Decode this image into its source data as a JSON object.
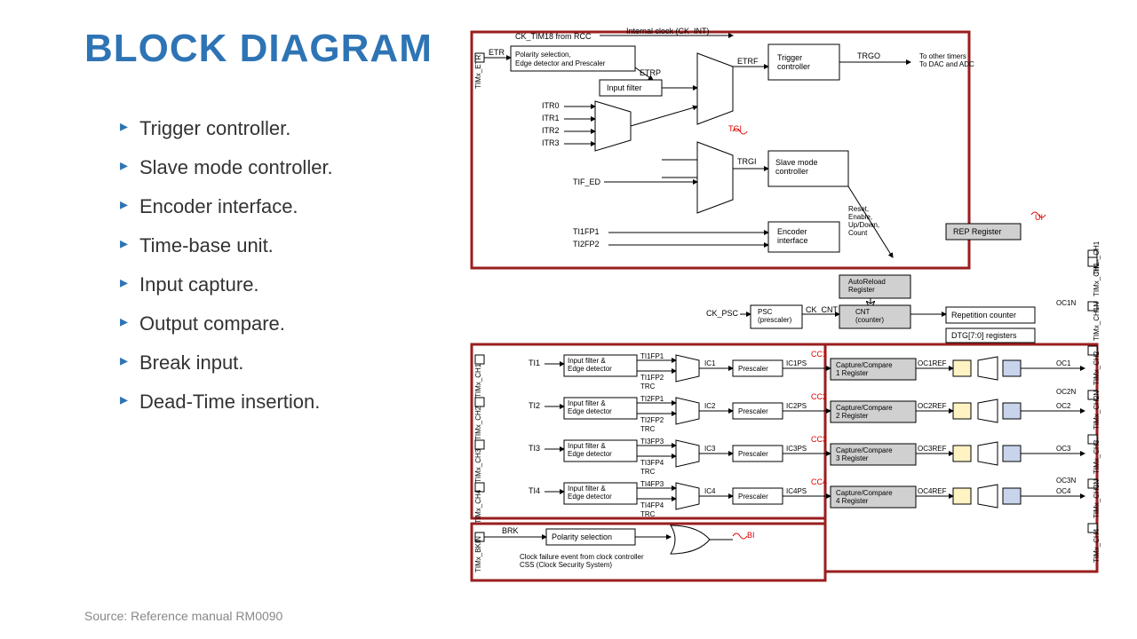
{
  "title": "BLOCK DIAGRAM",
  "bullets": [
    "Trigger controller.",
    "Slave mode controller.",
    "Encoder interface.",
    "Time-base unit.",
    "Input capture.",
    "Output compare.",
    "Break input.",
    "Dead-Time insertion."
  ],
  "source": "Source: Reference manual RM0090",
  "d": {
    "etr_pin": "TIMx_ETR",
    "etr": "ETR",
    "ck_tim18": "CK_TIM18 from RCC",
    "pol": "Polarity selection,\nEdge detector and Prescaler",
    "etrp": "ETRP",
    "inpfilt": "Input filter",
    "etrf": "ETRF",
    "ck_int": "Internal clock (CK_INT)",
    "trigctrl": "Trigger\ncontroller",
    "trgo": "TRGO",
    "to_other": "To other timers\nTo DAC and ADC",
    "itr0": "ITR0",
    "itr1": "ITR1",
    "itr2": "ITR2",
    "itr3": "ITR3",
    "tgi": "TGI",
    "trgi": "TRGI",
    "slave": "Slave mode\ncontroller",
    "tif_ed": "TIF_ED",
    "ti1fp1": "TI1FP1",
    "ti2fp2": "TI2FP2",
    "encoder": "Encoder\ninterface",
    "reset_etc": "Reset,\nEnable,\nUp/Down,\nCount",
    "rep": "REP Register",
    "ui": "UI",
    "arl": "AutoReload\nRegister",
    "ck_psc": "CK_PSC",
    "psc": "PSC\n(prescaler)",
    "ck_cnt": "CK_CNT",
    "cnt": "CNT\n(counter)",
    "repcnt": "Repetition counter",
    "dtg": "DTG[7:0] registers",
    "ch": [
      "TIMx_CH1",
      "TIMx_CH2",
      "TIMx_CH3",
      "TIMx_CH4"
    ],
    "chn": [
      "TIMx_CH1N",
      "TIMx_CH2N",
      "TIMx_CH3N",
      "TIMx_CH4"
    ],
    "ti": [
      "TI1",
      "TI2",
      "TI3",
      "TI4"
    ],
    "ife": "Input filter &\nEdge detector",
    "tifp": [
      [
        "TI1FP1",
        "TI1FP2"
      ],
      [
        "TI2FP1",
        "TI2FP2"
      ],
      [
        "TI3FP3",
        "TI3FP4"
      ],
      [
        "TI4FP3",
        "TI4FP4"
      ]
    ],
    "trc": "TRC",
    "ic": [
      "IC1",
      "IC2",
      "IC3",
      "IC4"
    ],
    "icps": [
      "IC1PS",
      "IC2PS",
      "IC3PS",
      "IC4PS"
    ],
    "presc": "Prescaler",
    "cc": [
      "Capture/Compare\n1 Register",
      "Capture/Compare\n2 Register",
      "Capture/Compare\n3 Register",
      "Capture/Compare\n4 Register"
    ],
    "cci": [
      "CC1",
      "CC2",
      "CC3",
      "CC4"
    ],
    "ocref": [
      "OC1REF",
      "OC2REF",
      "OC3REF",
      "OC4REF"
    ],
    "oc": [
      "OC1",
      "OC2",
      "OC3",
      "OC4"
    ],
    "ocn": [
      "OC1N",
      "OC2N",
      "OC3N"
    ],
    "bkin_pin": "TIMx_BKIN",
    "brk": "BRK",
    "polsel": "Polarity selection",
    "bi": "BI",
    "css": "Clock failure event from clock controller\nCSS (Clock Security System)",
    "ch1_out": "TIMx_CH1"
  }
}
